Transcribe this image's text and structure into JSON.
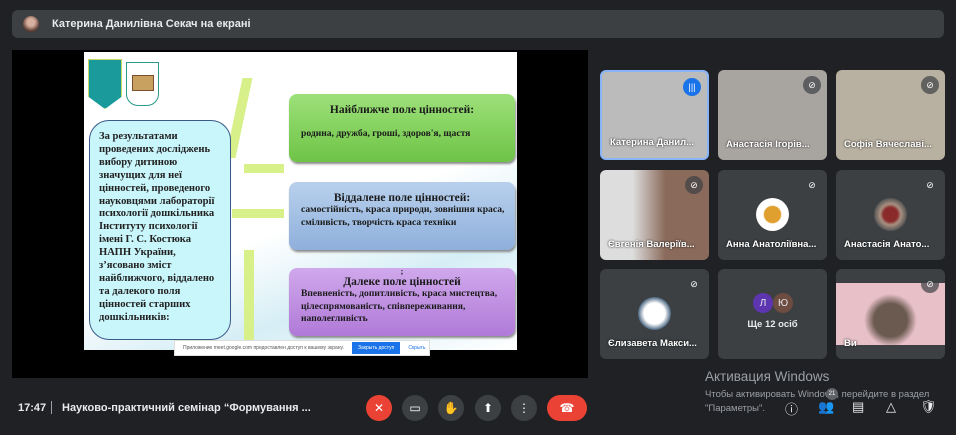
{
  "topbar": {
    "presenter_text": "Катерина Данилівна Секач на екрані"
  },
  "slide": {
    "left_text": "За результатами проведених досліджень вибору дитиною значущих для неї цінностей, проведеного науковцями лабораторії психології дошкільника Інституту психології імені Г. С. Костюка НАПН України, з’ясовано зміст найближчого, віддалено та далекого поля цінностей старших дошкільників:",
    "boxes": [
      {
        "title": "Найближче поле цінностей:",
        "text": "родина, дружба, гроші, здоров'я, щастя"
      },
      {
        "title": "Віддалене поле цінностей:",
        "text": "самостійність, краса природи, зовнішня краса, сміливість, творчість краса техніки"
      },
      {
        "title": "Далеке  поле цінностей",
        "prefix": ";",
        "text": "Впевненість, допитливість, краса мистецтва, цілеспрямованість, співпереживання, наполегливість"
      }
    ],
    "colors": {
      "green": "#7ed058",
      "blue": "#9dbce4",
      "purple": "#c090e0",
      "left": "#c9f6fb"
    }
  },
  "share_notice": {
    "text": "Приложение meet.google.com предоставлен доступ к вашему экрану.",
    "stop_button": "Закрыть доступ",
    "hide_link": "Скрыть"
  },
  "participants": [
    {
      "name": "Катерина Данил...",
      "speaking": true
    },
    {
      "name": "Анастасія Ігорів...",
      "muted": true
    },
    {
      "name": "Софія Вячеславі...",
      "muted": true
    },
    {
      "name": "Євгенія Валеріїв...",
      "muted": true
    },
    {
      "name": "Анна Анатоліївна...",
      "muted": true
    },
    {
      "name": "Анастасія Анато...",
      "muted": true
    },
    {
      "name": "Єлизавета Макси...",
      "muted": true
    },
    {
      "name": "Ще 12 осіб",
      "initials": [
        "Л",
        "Ю"
      ]
    },
    {
      "name": "Ви",
      "muted": true
    }
  ],
  "watermark": {
    "title": "Активация Windows",
    "text": "Чтобы активировать Windows, перейдите в раздел \"Параметры\"."
  },
  "bottom": {
    "time": "17:47",
    "meeting_title": "Науково-практичний семінар “Формування ...",
    "participants_count": "21"
  },
  "icons": {
    "mic": "mic-off-icon",
    "camera": "camera-icon",
    "hand": "raise-hand-icon",
    "present": "present-icon",
    "more": "more-vert-icon",
    "hangup": "call-end-icon"
  }
}
